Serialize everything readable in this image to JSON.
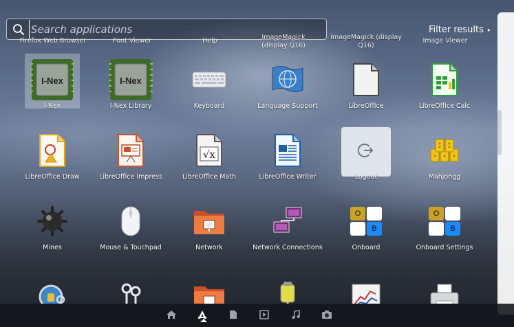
{
  "search": {
    "placeholder": "Search applications",
    "value": ""
  },
  "filter": {
    "label": "Filter results"
  },
  "partial_row": [
    "Firefox Web Browser",
    "Font Viewer",
    "Help",
    "ImageMagick (display Q16)",
    "ImageMagick (display Q16)",
    "Image Viewer"
  ],
  "apps": [
    {
      "label": "I-Nex",
      "icon": "i-nex-chip-icon"
    },
    {
      "label": "I-Nex Library",
      "icon": "i-nex-chip-icon"
    },
    {
      "label": "Keyboard",
      "icon": "keyboard-icon"
    },
    {
      "label": "Language Support",
      "icon": "language-support-icon"
    },
    {
      "label": "LibreOffice",
      "icon": "libreoffice-icon"
    },
    {
      "label": "LibreOffice Calc",
      "icon": "libreoffice-calc-icon"
    },
    {
      "label": "LibreOffice Draw",
      "icon": "libreoffice-draw-icon"
    },
    {
      "label": "LibreOffice Impress",
      "icon": "libreoffice-impress-icon"
    },
    {
      "label": "LibreOffice Math",
      "icon": "libreoffice-math-icon"
    },
    {
      "label": "LibreOffice Writer",
      "icon": "libreoffice-writer-icon"
    },
    {
      "label": "Logout",
      "icon": "logout-icon"
    },
    {
      "label": "Mahjongg",
      "icon": "mahjongg-icon"
    },
    {
      "label": "Mines",
      "icon": "mines-icon"
    },
    {
      "label": "Mouse & Touchpad",
      "icon": "mouse-icon"
    },
    {
      "label": "Network",
      "icon": "network-folder-icon"
    },
    {
      "label": "Network Connections",
      "icon": "network-connections-icon"
    },
    {
      "label": "Onboard",
      "icon": "onboard-icon"
    },
    {
      "label": "Onboard Settings",
      "icon": "onboard-settings-icon"
    }
  ],
  "onboard_keys": [
    "O",
    "B"
  ],
  "colors": {
    "libreoffice_calc": "#2e9e3a",
    "libreoffice_writer": "#1f5fa8",
    "libreoffice_impress": "#c8532b",
    "libreoffice_draw": "#f2b321",
    "onboard_blue": "#1a8cff",
    "onboard_gold": "#c9a227"
  },
  "lenses": [
    "home-lens-icon",
    "applications-lens-icon",
    "files-lens-icon",
    "video-lens-icon",
    "music-lens-icon",
    "photos-lens-icon"
  ],
  "active_lens": "applications-lens-icon"
}
